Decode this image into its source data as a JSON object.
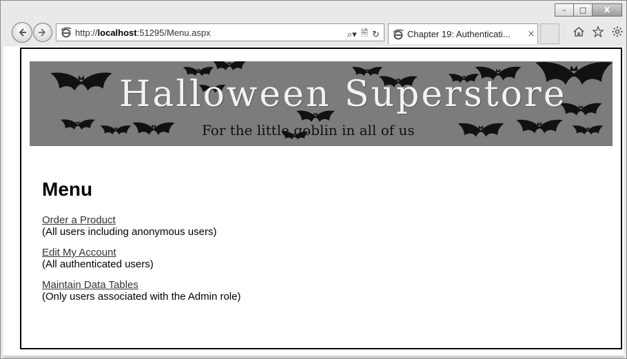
{
  "window": {
    "controls": {
      "minimize": "–",
      "maximize": "□",
      "close": "X"
    }
  },
  "toolbar": {
    "url_prefix": "http://",
    "url_host": "localhost",
    "url_rest": ":51295/Menu.aspx",
    "addr_tools": {
      "search": "⌕▾",
      "compat": "🗎",
      "refresh": "↻"
    }
  },
  "tabs": [
    {
      "title": "Chapter 19: Authenticati...",
      "close": "×",
      "active": true
    }
  ],
  "icons": {
    "back": "back-arrow-icon",
    "forward": "forward-arrow-icon",
    "home": "home-icon",
    "favorites": "star-icon",
    "tools": "gear-icon",
    "site": "ie-logo-icon"
  },
  "banner": {
    "title": "Halloween Superstore",
    "tagline": "For the little goblin in all of us"
  },
  "page": {
    "heading": "Menu",
    "items": [
      {
        "link": "Order a Product",
        "desc": "(All users including anonymous users)"
      },
      {
        "link": "Edit My Account",
        "desc": "(All authenticated users)"
      },
      {
        "link": "Maintain Data Tables",
        "desc": "(Only users associated with the Admin role)"
      }
    ]
  },
  "colors": {
    "banner_bg": "#7c7c7c",
    "link": "#333333",
    "frame": "#000000"
  }
}
